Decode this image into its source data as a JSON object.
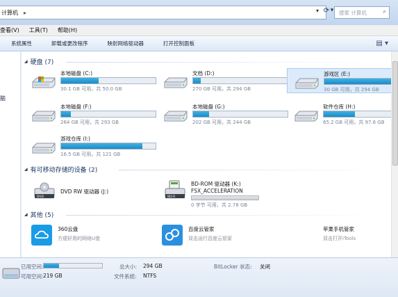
{
  "address": {
    "path": "计算机",
    "separator": "▸",
    "search_placeholder": "搜索 计算机"
  },
  "menu": [
    "查看(V)",
    "工具(T)",
    "帮助(H)"
  ],
  "toolbar": [
    "系统属性",
    "卸载或更改程序",
    "映射网络驱动器",
    "打开控制面板"
  ],
  "nav": {
    "label": "脑"
  },
  "groups": {
    "hdd": "硬盘 (7)",
    "removable": "有可移动存储的设备 (2)",
    "other": "其他 (5)"
  },
  "drives": [
    {
      "name": "本地磁盘 (C:)",
      "size": "30.1 GB 可用，共 50.0 GB",
      "used": 0.4
    },
    {
      "name": "文档 (D:)",
      "size": "270 GB 可用，共 294 GB",
      "used": 0.08
    },
    {
      "name": "游戏区 (E:)",
      "size": "30 GB 可用，共 294 GB",
      "used": 0.9,
      "selected": true
    },
    {
      "name": "本地磁盘 (F:)",
      "size": "264 GB 可用，共 293 GB",
      "used": 0.1
    },
    {
      "name": "本地磁盘 (G:)",
      "size": "202 GB 可用，共 244 GB",
      "used": 0.17
    },
    {
      "name": "软件仓库 (H:)",
      "size": "65.2 GB 可用，共 97.6 GB",
      "used": 0.33
    },
    {
      "name": "游戏仓库 (I:)",
      "size": "16.5 GB 可用，共 121 GB",
      "used": 0.86
    }
  ],
  "devices": [
    {
      "name": "DVD RW 驱动器 (J:)"
    },
    {
      "name": "BD-ROM 驱动器 (K:)",
      "label": "FSX_ACCELERATION",
      "size": "0 字节 可用，共 2.78 GB",
      "used": 1.0
    }
  ],
  "others": [
    {
      "name": "360云盘",
      "sub": "方便好用的网络U盘",
      "color": "#1a9be6"
    },
    {
      "name": "百度云管家",
      "sub": "双击运行百度云管家",
      "color": "#2b8fe0"
    },
    {
      "name": "苹果手机管家",
      "sub": "双击打开iTools",
      "color": "#ffffff"
    }
  ],
  "details": {
    "used_label": "已用空间:",
    "free_label": "可用空间:",
    "free_value": "219 GB",
    "used_fraction": 0.26,
    "total_label": "总大小:",
    "total_value": "294 GB",
    "fs_label": "文件系统:",
    "fs_value": "NTFS",
    "bitlocker_label": "BitLocker 状态:",
    "bitlocker_value": "关闭"
  }
}
